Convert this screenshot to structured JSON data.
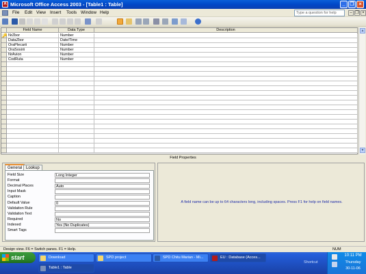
{
  "window": {
    "title": "Microsoft Office Access 2003 - [Table1 : Table]",
    "buttons": {
      "minimize": "_",
      "restore": "❐",
      "close": "×"
    }
  },
  "menu": {
    "items": [
      "File",
      "Edit",
      "View",
      "Insert",
      "Tools",
      "Window",
      "Help"
    ],
    "help_placeholder": "Type a question for help"
  },
  "grid": {
    "headers": {
      "field_name": "Field Name",
      "data_type": "Data Type",
      "description": "Description"
    },
    "rows": [
      {
        "field": "NrZbor",
        "type": "Number"
      },
      {
        "field": "DataZbor",
        "type": "Date/Time"
      },
      {
        "field": "OraPlecarii",
        "type": "Number"
      },
      {
        "field": "OraSosirii",
        "type": "Number"
      },
      {
        "field": "NrAvion",
        "type": "Number"
      },
      {
        "field": "CodRuta",
        "type": "Number"
      }
    ]
  },
  "field_properties": {
    "title": "Field Properties",
    "tabs": [
      "General",
      "Lookup"
    ],
    "properties": [
      {
        "label": "Field Size",
        "value": "Long Integer"
      },
      {
        "label": "Format",
        "value": ""
      },
      {
        "label": "Decimal Places",
        "value": "Auto"
      },
      {
        "label": "Input Mask",
        "value": ""
      },
      {
        "label": "Caption",
        "value": ""
      },
      {
        "label": "Default Value",
        "value": "0"
      },
      {
        "label": "Validation Rule",
        "value": ""
      },
      {
        "label": "Validation Text",
        "value": ""
      },
      {
        "label": "Required",
        "value": "No"
      },
      {
        "label": "Indexed",
        "value": "Yes (No Duplicates)"
      },
      {
        "label": "Smart Tags",
        "value": ""
      }
    ],
    "hint": "A field name can be up to 64 characters long, including spaces.  Press F1 for help on field names."
  },
  "status": {
    "left": "Design view.  F6 = Switch panes.  F1 = Help.",
    "right": "NUM"
  },
  "taskbar": {
    "start_label": "start",
    "tasks": [
      {
        "label": "Download"
      },
      {
        "label": "SPD project"
      },
      {
        "label": "SPD Chitu Marian - Mi..."
      },
      {
        "label": "EU : Database (Acces..."
      },
      {
        "label": "Table1 : Table"
      }
    ],
    "tray": {
      "shortcut": "Shortcut",
      "time": "10:11 PM",
      "day": "Thursday",
      "date": "30-11-06"
    }
  }
}
